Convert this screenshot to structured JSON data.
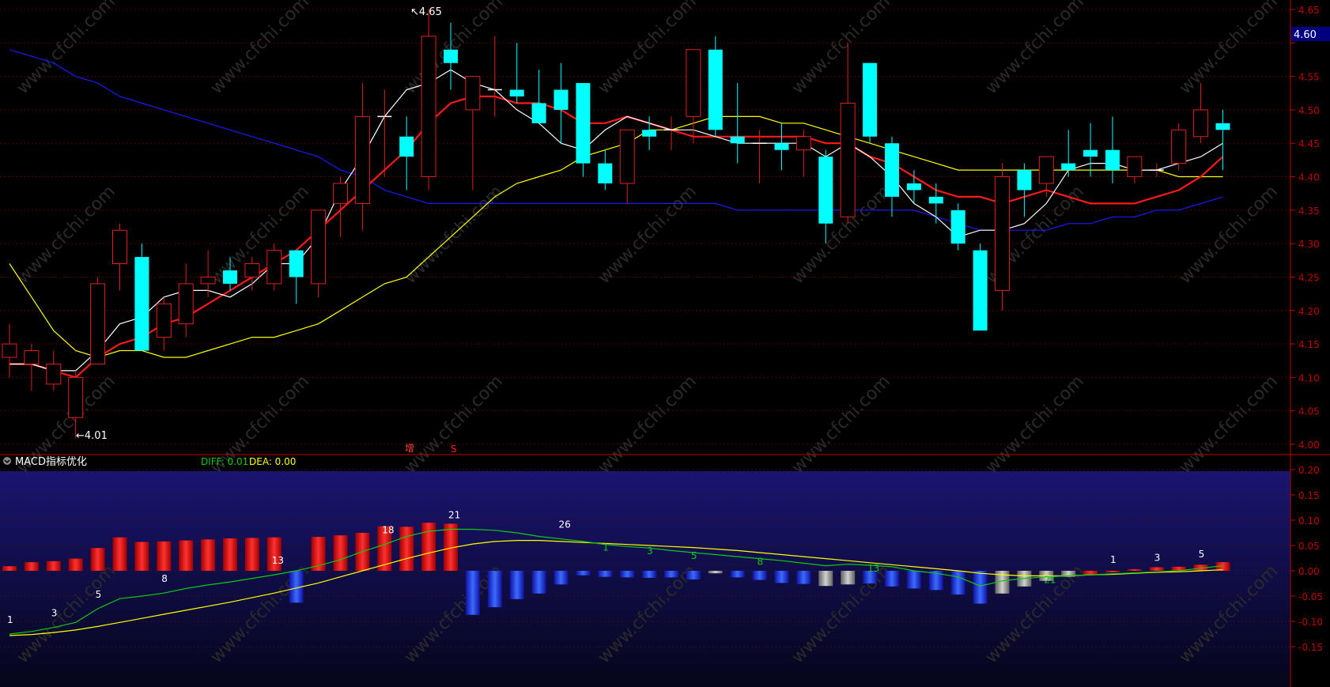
{
  "colors": {
    "background": "#000000",
    "up_candle": "#e02020",
    "down_candle": "#00ffff",
    "axis_red": "#c00000",
    "ma_short": "#ffffff",
    "ma_mid": "#ff1a1a",
    "ma_long": "#ffff00",
    "ma_longest": "#1a1aff",
    "diff_line": "#14c814",
    "dea_line": "#ffff00",
    "macd_pos": "#ff2020",
    "macd_neg": "#1e3cff",
    "macd_gray": "#b0b0b0",
    "watermark": "#2a2a2a"
  },
  "header": {
    "title_fragment": "",
    "marker_red": "S",
    "marker_white": "增"
  },
  "price_axis": {
    "ticks": [
      "4.65",
      "4.60",
      "4.55",
      "4.50",
      "4.45",
      "4.40",
      "4.35",
      "4.30",
      "4.25",
      "4.20",
      "4.15",
      "4.10",
      "4.05",
      "4.00"
    ],
    "current_price": "4.60",
    "current_price_bg": "#000080"
  },
  "annotations": {
    "high": "4.65",
    "low": "4.01"
  },
  "macd_panel": {
    "title": "MACD指标优化",
    "diff_label": "DIFF: 0.01",
    "dea_label": "DEA: 0.00",
    "axis_ticks": [
      "0.20",
      "0.15",
      "0.10",
      "0.05",
      "0.00",
      "-0.05",
      "-0.10",
      "-0.15"
    ]
  },
  "watermark_text": "www.cfchi.com",
  "chart_data": [
    {
      "type": "candlestick",
      "ylim": [
        4.0,
        4.65
      ],
      "candles": [
        {
          "o": 4.13,
          "h": 4.18,
          "l": 4.1,
          "c": 4.15
        },
        {
          "o": 4.12,
          "h": 4.15,
          "l": 4.08,
          "c": 4.14
        },
        {
          "o": 4.09,
          "h": 4.14,
          "l": 4.08,
          "c": 4.12
        },
        {
          "o": 4.04,
          "h": 4.11,
          "l": 4.01,
          "c": 4.1
        },
        {
          "o": 4.12,
          "h": 4.25,
          "l": 4.12,
          "c": 4.24
        },
        {
          "o": 4.27,
          "h": 4.33,
          "l": 4.23,
          "c": 4.32
        },
        {
          "o": 4.28,
          "h": 4.3,
          "l": 4.14,
          "c": 4.14
        },
        {
          "o": 4.16,
          "h": 4.22,
          "l": 4.14,
          "c": 4.21
        },
        {
          "o": 4.18,
          "h": 4.27,
          "l": 4.16,
          "c": 4.24
        },
        {
          "o": 4.24,
          "h": 4.29,
          "l": 4.22,
          "c": 4.25
        },
        {
          "o": 4.26,
          "h": 4.28,
          "l": 4.23,
          "c": 4.24
        },
        {
          "o": 4.25,
          "h": 4.28,
          "l": 4.23,
          "c": 4.27
        },
        {
          "o": 4.24,
          "h": 4.3,
          "l": 4.23,
          "c": 4.29
        },
        {
          "o": 4.29,
          "h": 4.29,
          "l": 4.21,
          "c": 4.25
        },
        {
          "o": 4.24,
          "h": 4.34,
          "l": 4.22,
          "c": 4.35
        },
        {
          "o": 4.36,
          "h": 4.4,
          "l": 4.31,
          "c": 4.39
        },
        {
          "o": 4.36,
          "h": 4.54,
          "l": 4.32,
          "c": 4.49
        },
        {
          "o": 4.49,
          "h": 4.53,
          "l": 4.4,
          "c": 4.49
        },
        {
          "o": 4.46,
          "h": 4.49,
          "l": 4.38,
          "c": 4.43
        },
        {
          "o": 4.4,
          "h": 4.65,
          "l": 4.38,
          "c": 4.61
        },
        {
          "o": 4.59,
          "h": 4.63,
          "l": 4.53,
          "c": 4.57
        },
        {
          "o": 4.5,
          "h": 4.55,
          "l": 4.38,
          "c": 4.55
        },
        {
          "o": 4.53,
          "h": 4.61,
          "l": 4.49,
          "c": 4.53
        },
        {
          "o": 4.53,
          "h": 4.6,
          "l": 4.51,
          "c": 4.52
        },
        {
          "o": 4.51,
          "h": 4.56,
          "l": 4.49,
          "c": 4.48
        },
        {
          "o": 4.53,
          "h": 4.57,
          "l": 4.45,
          "c": 4.5
        },
        {
          "o": 4.54,
          "h": 4.54,
          "l": 4.4,
          "c": 4.42
        },
        {
          "o": 4.42,
          "h": 4.44,
          "l": 4.38,
          "c": 4.39
        },
        {
          "o": 4.39,
          "h": 4.47,
          "l": 4.36,
          "c": 4.47
        },
        {
          "o": 4.47,
          "h": 4.49,
          "l": 4.44,
          "c": 4.46
        },
        {
          "o": 4.47,
          "h": 4.49,
          "l": 4.44,
          "c": 4.47
        },
        {
          "o": 4.49,
          "h": 4.59,
          "l": 4.45,
          "c": 4.59
        },
        {
          "o": 4.59,
          "h": 4.61,
          "l": 4.46,
          "c": 4.47
        },
        {
          "o": 4.46,
          "h": 4.54,
          "l": 4.42,
          "c": 4.45
        },
        {
          "o": 4.45,
          "h": 4.47,
          "l": 4.39,
          "c": 4.45
        },
        {
          "o": 4.45,
          "h": 4.48,
          "l": 4.41,
          "c": 4.44
        },
        {
          "o": 4.44,
          "h": 4.47,
          "l": 4.4,
          "c": 4.46
        },
        {
          "o": 4.43,
          "h": 4.44,
          "l": 4.3,
          "c": 4.33
        },
        {
          "o": 4.34,
          "h": 4.6,
          "l": 4.33,
          "c": 4.51
        },
        {
          "o": 4.57,
          "h": 4.57,
          "l": 4.45,
          "c": 4.46
        },
        {
          "o": 4.45,
          "h": 4.46,
          "l": 4.34,
          "c": 4.37
        },
        {
          "o": 4.39,
          "h": 4.41,
          "l": 4.36,
          "c": 4.38
        },
        {
          "o": 4.37,
          "h": 4.39,
          "l": 4.33,
          "c": 4.36
        },
        {
          "o": 4.35,
          "h": 4.36,
          "l": 4.29,
          "c": 4.3
        },
        {
          "o": 4.29,
          "h": 4.3,
          "l": 4.17,
          "c": 4.17
        },
        {
          "o": 4.23,
          "h": 4.42,
          "l": 4.2,
          "c": 4.4
        },
        {
          "o": 4.41,
          "h": 4.42,
          "l": 4.34,
          "c": 4.38
        },
        {
          "o": 4.39,
          "h": 4.43,
          "l": 4.37,
          "c": 4.43
        },
        {
          "o": 4.42,
          "h": 4.47,
          "l": 4.4,
          "c": 4.41
        },
        {
          "o": 4.44,
          "h": 4.48,
          "l": 4.4,
          "c": 4.43
        },
        {
          "o": 4.44,
          "h": 4.49,
          "l": 4.39,
          "c": 4.41
        },
        {
          "o": 4.4,
          "h": 4.43,
          "l": 4.39,
          "c": 4.43
        },
        {
          "o": 4.41,
          "h": 4.42,
          "l": 4.4,
          "c": 4.41
        },
        {
          "o": 4.42,
          "h": 4.48,
          "l": 4.41,
          "c": 4.47
        },
        {
          "o": 4.46,
          "h": 4.54,
          "l": 4.45,
          "c": 4.5
        },
        {
          "o": 4.48,
          "h": 4.5,
          "l": 4.41,
          "c": 4.47
        }
      ],
      "ma_white": [
        4.12,
        4.12,
        4.11,
        4.11,
        4.14,
        4.18,
        4.19,
        4.22,
        4.23,
        4.23,
        4.22,
        4.24,
        4.27,
        4.27,
        4.31,
        4.38,
        4.43,
        4.49,
        4.53,
        4.54,
        4.56,
        4.54,
        4.53,
        4.5,
        4.48,
        4.45,
        4.44,
        4.47,
        4.49,
        4.48,
        4.47,
        4.47,
        4.46,
        4.45,
        4.45,
        4.45,
        4.45,
        4.43,
        4.45,
        4.43,
        4.4,
        4.36,
        4.34,
        4.31,
        4.32,
        4.32,
        4.33,
        4.36,
        4.41,
        4.42,
        4.42,
        4.41,
        4.41,
        4.42,
        4.43,
        4.45
      ],
      "ma_red": [
        4.12,
        4.12,
        4.11,
        4.1,
        4.13,
        4.15,
        4.16,
        4.18,
        4.19,
        4.21,
        4.23,
        4.25,
        4.27,
        4.29,
        4.32,
        4.35,
        4.38,
        4.41,
        4.44,
        4.48,
        4.51,
        4.52,
        4.52,
        4.51,
        4.51,
        4.5,
        4.48,
        4.48,
        4.49,
        4.48,
        4.47,
        4.46,
        4.46,
        4.46,
        4.46,
        4.46,
        4.46,
        4.45,
        4.45,
        4.43,
        4.42,
        4.4,
        4.38,
        4.37,
        4.37,
        4.36,
        4.37,
        4.38,
        4.37,
        4.36,
        4.36,
        4.36,
        4.37,
        4.38,
        4.4,
        4.43
      ],
      "ma_yellow": [
        4.27,
        4.22,
        4.17,
        4.14,
        4.13,
        4.14,
        4.14,
        4.13,
        4.13,
        4.14,
        4.15,
        4.16,
        4.16,
        4.17,
        4.18,
        4.2,
        4.22,
        4.24,
        4.25,
        4.28,
        4.31,
        4.34,
        4.37,
        4.39,
        4.4,
        4.41,
        4.43,
        4.44,
        4.45,
        4.47,
        4.47,
        4.48,
        4.49,
        4.49,
        4.49,
        4.48,
        4.48,
        4.47,
        4.46,
        4.45,
        4.44,
        4.43,
        4.42,
        4.41,
        4.41,
        4.41,
        4.41,
        4.41,
        4.41,
        4.41,
        4.41,
        4.41,
        4.41,
        4.4,
        4.4,
        4.4
      ],
      "ma_blue": [
        4.59,
        4.58,
        4.57,
        4.55,
        4.54,
        4.52,
        4.51,
        4.5,
        4.49,
        4.48,
        4.47,
        4.46,
        4.45,
        4.44,
        4.43,
        4.41,
        4.4,
        4.38,
        4.37,
        4.36,
        4.36,
        4.36,
        4.36,
        4.36,
        4.36,
        4.36,
        4.36,
        4.36,
        4.36,
        4.36,
        4.36,
        4.36,
        4.36,
        4.35,
        4.35,
        4.35,
        4.35,
        4.35,
        4.35,
        4.35,
        4.35,
        4.35,
        4.34,
        4.33,
        4.32,
        4.32,
        4.32,
        4.32,
        4.33,
        4.33,
        4.34,
        4.34,
        4.35,
        4.35,
        4.36,
        4.37
      ]
    },
    {
      "type": "bar",
      "ylim": [
        -0.2,
        0.2
      ],
      "histogram": [
        0.009,
        0.017,
        0.019,
        0.024,
        0.045,
        0.066,
        0.057,
        0.058,
        0.06,
        0.062,
        0.064,
        0.065,
        0.066,
        -0.063,
        0.067,
        0.07,
        0.075,
        0.088,
        0.087,
        0.095,
        0.093,
        -0.087,
        -0.072,
        -0.056,
        -0.045,
        -0.027,
        -0.009,
        -0.012,
        -0.013,
        -0.014,
        -0.013,
        -0.017,
        -0.005,
        -0.013,
        -0.018,
        -0.024,
        -0.026,
        -0.03,
        -0.027,
        -0.025,
        -0.031,
        -0.035,
        -0.038,
        -0.047,
        -0.065,
        -0.045,
        -0.031,
        -0.02,
        -0.012,
        -0.008,
        -0.003,
        0.003,
        0.007,
        0.008,
        0.012,
        0.017
      ],
      "hist_kind": [
        "r",
        "r",
        "r",
        "r",
        "r",
        "r",
        "r",
        "r",
        "r",
        "r",
        "r",
        "r",
        "r",
        "b",
        "r",
        "r",
        "r",
        "r",
        "r",
        "r",
        "r",
        "b",
        "b",
        "b",
        "b",
        "b",
        "b",
        "b",
        "b",
        "b",
        "b",
        "b",
        "g",
        "b",
        "b",
        "b",
        "b",
        "g",
        "g",
        "b",
        "b",
        "b",
        "b",
        "b",
        "b",
        "g",
        "g",
        "g",
        "g",
        "r",
        "r",
        "r",
        "r",
        "r",
        "r",
        "r"
      ],
      "diff": [
        -0.125,
        -0.12,
        -0.112,
        -0.102,
        -0.075,
        -0.055,
        -0.05,
        -0.044,
        -0.035,
        -0.028,
        -0.022,
        -0.015,
        -0.008,
        0.0,
        0.01,
        0.022,
        0.038,
        0.052,
        0.068,
        0.078,
        0.082,
        0.082,
        0.08,
        0.075,
        0.068,
        0.063,
        0.058,
        0.052,
        0.048,
        0.045,
        0.04,
        0.036,
        0.032,
        0.028,
        0.024,
        0.02,
        0.015,
        0.01,
        0.013,
        0.011,
        0.008,
        0.0,
        -0.005,
        -0.012,
        -0.03,
        -0.02,
        -0.015,
        -0.012,
        -0.01,
        -0.008,
        -0.006,
        -0.004,
        -0.002,
        0.0,
        0.005,
        0.01
      ],
      "dea": [
        -0.128,
        -0.126,
        -0.122,
        -0.117,
        -0.11,
        -0.102,
        -0.094,
        -0.086,
        -0.078,
        -0.07,
        -0.062,
        -0.053,
        -0.044,
        -0.034,
        -0.024,
        -0.012,
        0.0,
        0.012,
        0.024,
        0.035,
        0.045,
        0.053,
        0.058,
        0.06,
        0.06,
        0.058,
        0.056,
        0.054,
        0.052,
        0.05,
        0.048,
        0.046,
        0.043,
        0.04,
        0.036,
        0.032,
        0.028,
        0.024,
        0.02,
        0.016,
        0.012,
        0.008,
        0.004,
        0.0,
        -0.005,
        -0.008,
        -0.01,
        -0.01,
        -0.01,
        -0.008,
        -0.007,
        -0.005,
        -0.003,
        -0.002,
        0.0,
        0.002
      ],
      "count_labels_white": [
        {
          "i": 0,
          "text": "1"
        },
        {
          "i": 2,
          "text": "3"
        },
        {
          "i": 4,
          "text": "5"
        },
        {
          "i": 7,
          "text": "8"
        },
        {
          "i": 12,
          "text": "13"
        },
        {
          "i": 17,
          "text": "18"
        },
        {
          "i": 20,
          "text": "21"
        },
        {
          "i": 25,
          "text": "26"
        },
        {
          "i": 50,
          "text": "1"
        },
        {
          "i": 52,
          "text": "3"
        },
        {
          "i": 54,
          "text": "5"
        }
      ],
      "count_labels_green": [
        {
          "i": 27,
          "text": "1"
        },
        {
          "i": 29,
          "text": "3"
        },
        {
          "i": 31,
          "text": "5"
        },
        {
          "i": 34,
          "text": "8"
        },
        {
          "i": 39,
          "text": "13"
        },
        {
          "i": 47,
          "text": "21"
        }
      ]
    }
  ]
}
